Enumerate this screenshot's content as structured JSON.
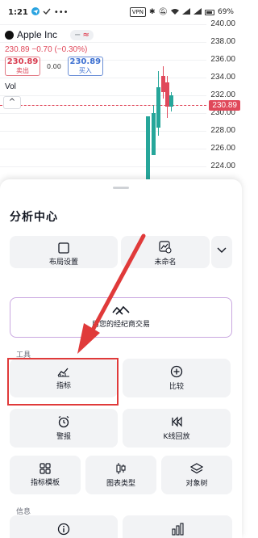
{
  "status_bar": {
    "time": "1:21",
    "vpn": "VPN",
    "battery": "69%"
  },
  "chart": {
    "symbol": "Apple Inc",
    "pill_a": "−",
    "pill_b": "≈",
    "change": "230.89  −0.70 (−0.30%)",
    "sell_price": "230.89",
    "sell_label": "卖出",
    "spread": "0.00",
    "buy_price": "230.89",
    "buy_label": "买入",
    "volume_label": "Vol",
    "collapse_glyph": "^",
    "price_ticks": [
      "240.00",
      "238.00",
      "236.00",
      "234.00",
      "232.00",
      "230.00",
      "228.00",
      "226.00",
      "224.00"
    ],
    "current_price": "230.89",
    "colors": {
      "up": "#26a69a",
      "down": "#e0485a"
    }
  },
  "sheet": {
    "title": "分析中心",
    "layout_label": "布局设置",
    "unnamed_label": "未命名",
    "broker_label": "用您的经纪商交易",
    "tools_section": "工具",
    "info_section": "信息",
    "tools": [
      {
        "label": "指标",
        "icon": "indicator-icon"
      },
      {
        "label": "比较",
        "icon": "plus-circle-icon"
      },
      {
        "label": "警报",
        "icon": "alarm-icon"
      },
      {
        "label": "K线回放",
        "icon": "rewind-icon"
      },
      {
        "label": "指标模板",
        "icon": "grid-icon"
      },
      {
        "label": "图表类型",
        "icon": "candles-icon"
      },
      {
        "label": "对象树",
        "icon": "layers-icon"
      }
    ]
  }
}
